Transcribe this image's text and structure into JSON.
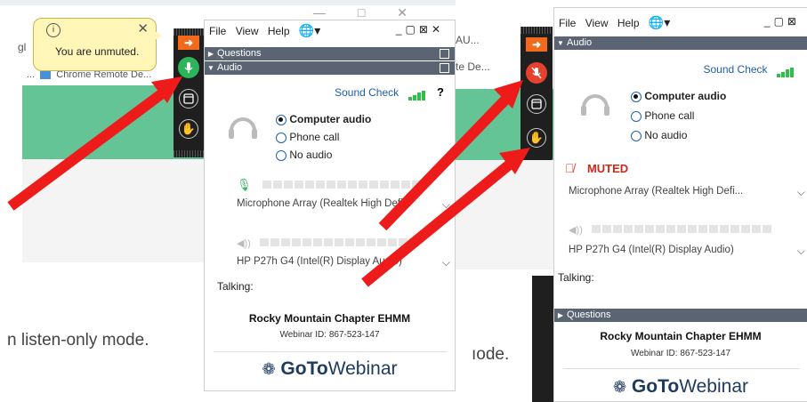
{
  "left_bg": {
    "bookmark_prefix": "...",
    "bookmark_text": "Chrome Remote De...",
    "addr_fragment": "gl",
    "listen_text": "n listen-only mode."
  },
  "right_bg": {
    "addr_fragment": "AU...",
    "bookmark_text": "te De...",
    "mode_text": "ıode."
  },
  "tooltip": {
    "info_icon": "info-icon",
    "text": "You are unmuted.",
    "close": "✕"
  },
  "left_window": {
    "menu": [
      "File",
      "View",
      "Help"
    ],
    "sections": {
      "questions": "Questions",
      "audio": "Audio"
    },
    "sound_check": "Sound Check",
    "help": "?",
    "options": [
      "Computer audio",
      "Phone call",
      "No audio"
    ],
    "selected_option": "Computer audio",
    "mic_device": "Microphone Array (Realtek High Defi...",
    "speaker_device": "HP P27h G4 (Intel(R) Display Audio)",
    "talking_label": "Talking:",
    "organizer": "Rocky Mountain Chapter EHMM",
    "webinar_id": "Webinar ID: 867-523-147",
    "logo": {
      "goto": "GoTo",
      "webinar": "Webinar"
    }
  },
  "right_window": {
    "menu": [
      "File",
      "View",
      "Help"
    ],
    "sections": {
      "audio": "Audio",
      "questions": "Questions"
    },
    "sound_check": "Sound Check",
    "options": [
      "Computer audio",
      "Phone call",
      "No audio"
    ],
    "selected_option": "Computer audio",
    "muted_label": "MUTED",
    "mic_device": "Microphone Array (Realtek High Defi...",
    "speaker_device": "HP P27h G4 (Intel(R) Display Audio)",
    "talking_label": "Talking:",
    "organizer": "Rocky Mountain Chapter EHMM",
    "webinar_id": "Webinar ID: 867-523-147",
    "logo": {
      "goto": "GoTo",
      "webinar": "Webinar"
    }
  },
  "colors": {
    "unmuted_mic": "#2db35a",
    "muted_mic": "#e5412e",
    "arrow": "#ee1b1b",
    "section_bar": "#5a6472",
    "accent": "#1f5fb0",
    "green_band": "#64c495"
  }
}
